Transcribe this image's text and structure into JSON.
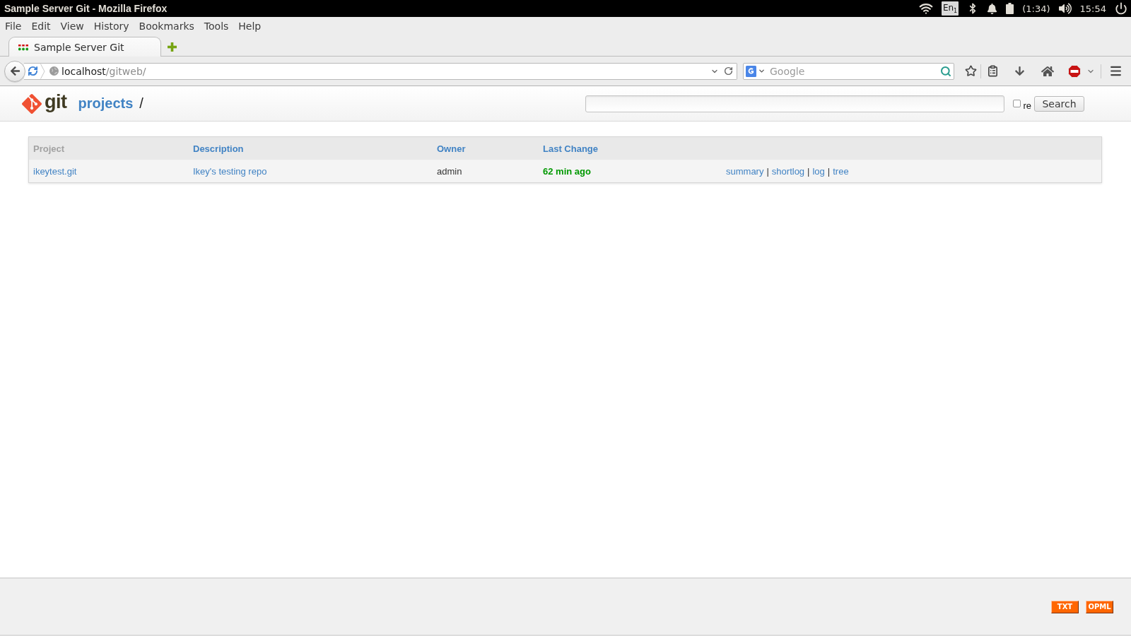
{
  "system_bar": {
    "window_title": "Sample Server Git - Mozilla Firefox",
    "keyboard_layout": "En$_{1}$",
    "battery_time": "(1:34)",
    "clock": "15:54"
  },
  "menu_bar": [
    "File",
    "Edit",
    "View",
    "History",
    "Bookmarks",
    "Tools",
    "Help"
  ],
  "tabs": [
    {
      "label": "Sample Server Git",
      "selected": true
    }
  ],
  "nav_bar": {
    "url_host": "localhost",
    "url_path": "/gitweb/",
    "search_placeholder": "Google"
  },
  "page_header": {
    "logo_text": "git",
    "breadcrumb": "projects",
    "separator": "/",
    "regex_option": {
      "label": "re",
      "checked": false
    },
    "search_button": "Search"
  },
  "table": {
    "columns": [
      {
        "label": "Project",
        "selected": true
      },
      {
        "label": "Description",
        "selected": false
      },
      {
        "label": "Owner",
        "selected": false
      },
      {
        "label": "Last Change",
        "selected": false
      }
    ],
    "rows": [
      {
        "project": "ikeytest.git",
        "description": "Ikey's testing repo",
        "owner": "admin",
        "last_change": "62 min ago",
        "links": [
          "summary",
          "shortlog",
          "log",
          "tree"
        ],
        "link_separators": [
          "|",
          "|",
          "|"
        ]
      }
    ]
  },
  "footer": {
    "feeds": [
      "TXT",
      "OPML"
    ]
  }
}
